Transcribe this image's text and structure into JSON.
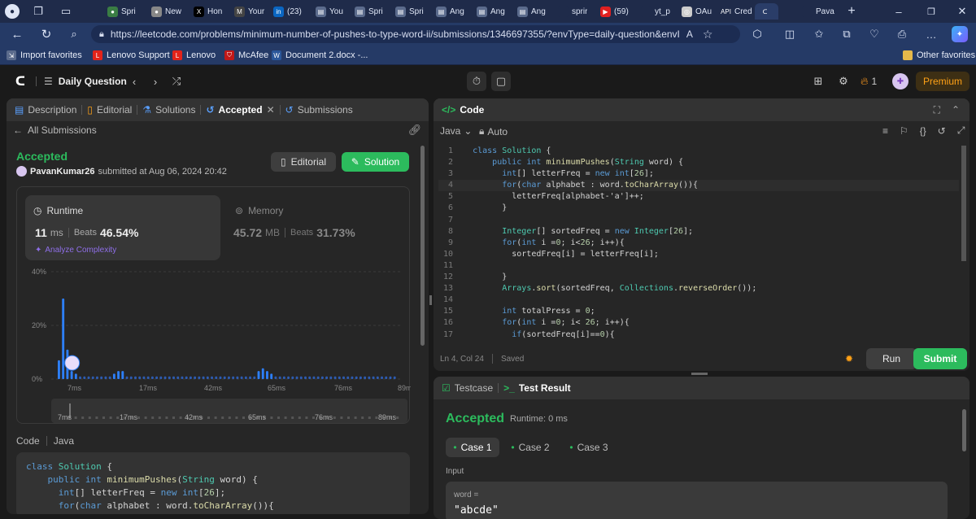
{
  "browser": {
    "tabs": [
      {
        "label": "Spri",
        "icon": "circle-icon",
        "color": "#3a7d44"
      },
      {
        "label": "New",
        "icon": "circle-icon",
        "color": "#888888"
      },
      {
        "label": "Hon",
        "icon": "x-icon",
        "color": "#000000"
      },
      {
        "label": "Your",
        "icon": "gmail-icon",
        "color": "#444444"
      },
      {
        "label": "(23)",
        "icon": "linkedin-icon",
        "color": "#0a66c2"
      },
      {
        "label": "You",
        "icon": "page-icon",
        "color": "#5b6b8c"
      },
      {
        "label": "Spri",
        "icon": "page-icon",
        "color": "#5b6b8c"
      },
      {
        "label": "Spri",
        "icon": "page-icon",
        "color": "#5b6b8c"
      },
      {
        "label": "Ang",
        "icon": "page-icon",
        "color": "#5b6b8c"
      },
      {
        "label": "Ang",
        "icon": "page-icon",
        "color": "#5b6b8c"
      },
      {
        "label": "Ang",
        "icon": "page-icon",
        "color": "#5b6b8c"
      },
      {
        "label": "sprir",
        "icon": "blank-icon",
        "color": "#1f2b4a"
      },
      {
        "label": "(59)",
        "icon": "youtube-icon",
        "color": "#e02020"
      },
      {
        "label": "yt_p",
        "icon": "blank-icon",
        "color": "#1f2b4a"
      },
      {
        "label": "OAu",
        "icon": "openai-icon",
        "color": "#cccccc"
      },
      {
        "label": "Cred",
        "icon": "api-icon",
        "color": "#1f2b4a"
      },
      {
        "label": "",
        "icon": "leetcode-icon",
        "color": "#2a3d68"
      },
      {
        "label": "Pava",
        "icon": "blank-icon",
        "color": "#1f2b4a"
      }
    ],
    "url": "https://leetcode.com/problems/minimum-number-of-pushes-to-type-word-ii/submissions/1346697355/?envType=daily-question&envI...",
    "favorites": [
      {
        "label": "Import favorites",
        "icon": "import-icon",
        "color": "#5b6b8c"
      },
      {
        "label": "Lenovo Support",
        "icon": "L",
        "color": "#e2231a"
      },
      {
        "label": "Lenovo",
        "icon": "L",
        "color": "#e2231a"
      },
      {
        "label": "McAfee",
        "icon": "shield-icon",
        "color": "#c01818"
      },
      {
        "label": "Document 2.docx -...",
        "icon": "W",
        "color": "#2b579a"
      }
    ],
    "other_favorites": "Other favorites"
  },
  "nav": {
    "daily": "Daily Question",
    "streak": "1",
    "premium": "Premium"
  },
  "left": {
    "tabs": [
      "Description",
      "Editorial",
      "Solutions",
      "Accepted",
      "Submissions"
    ],
    "back": "All Submissions",
    "status": "Accepted",
    "user": "PavanKumar26",
    "submitted": "submitted at Aug 06, 2024 20:42",
    "editorial_btn": "Editorial",
    "solution_btn": "Solution",
    "runtime": {
      "title": "Runtime",
      "value": "11",
      "unit": "ms",
      "beats_label": "Beats",
      "beats": "46.54%",
      "analyze": "Analyze Complexity"
    },
    "memory": {
      "title": "Memory",
      "value": "45.72",
      "unit": "MB",
      "beats_label": "Beats",
      "beats": "31.73%"
    },
    "code_label": "Code",
    "code_lang": "Java"
  },
  "chart_data": {
    "type": "bar",
    "y_ticks": [
      "40%",
      "20%",
      "0%"
    ],
    "ylim": [
      0,
      40
    ],
    "x_ticks": [
      "7ms",
      "17ms",
      "42ms",
      "65ms",
      "76ms",
      "89ms"
    ],
    "values": [
      7,
      30,
      11,
      3,
      2,
      1,
      1,
      1,
      1,
      1,
      1,
      1,
      1,
      2,
      3,
      3,
      1,
      1,
      1,
      1,
      1,
      1,
      1,
      1,
      1,
      1,
      1,
      1,
      1,
      1,
      1,
      1,
      1,
      1,
      1,
      1,
      1,
      1,
      1,
      1,
      1,
      1,
      1,
      1,
      1,
      1,
      1,
      3,
      4,
      3,
      2,
      1,
      1,
      1,
      1,
      1,
      1,
      1,
      1,
      1,
      1,
      1,
      1,
      1,
      1,
      1,
      1,
      1,
      1,
      1,
      1,
      1,
      1,
      1,
      1,
      1,
      1,
      1,
      1,
      1
    ],
    "highlight_index": 3,
    "mini_ticks": [
      "7ms",
      "17ms",
      "42ms",
      "65ms",
      "76ms",
      "89ms"
    ]
  },
  "editor": {
    "title": "Code",
    "lang": "Java",
    "mode": "Auto",
    "status_pos": "Ln 4, Col 24",
    "status_saved": "Saved",
    "run": "Run",
    "submit": "Submit",
    "lines": [
      "class Solution {",
      "    public int minimumPushes(String word) {",
      "      int[] letterFreq = new int[26];",
      "      for(char alphabet : word.toCharArray()){",
      "        letterFreq[alphabet-'a']++;",
      "      }",
      "",
      "      Integer[] sortedFreq = new Integer[26];",
      "      for(int i =0; i<26; i++){",
      "        sortedFreq[i] = letterFreq[i];",
      "",
      "      }",
      "      Arrays.sort(sortedFreq, Collections.reverseOrder());",
      "",
      "      int totalPress = 0;",
      "      for(int i =0; i< 26; i++){",
      "        if(sortedFreq[i]==0){"
    ]
  },
  "submission_code": [
    "class Solution {",
    "    public int minimumPushes(String word) {",
    "      int[] letterFreq = new int[26];",
    "      for(char alphabet : word.toCharArray()){"
  ],
  "result": {
    "testcase_tab": "Testcase",
    "result_tab": "Test Result",
    "status": "Accepted",
    "runtime": "Runtime: 0 ms",
    "cases": [
      "Case 1",
      "Case 2",
      "Case 3"
    ],
    "input_label": "Input",
    "var_label": "word =",
    "var_value": "\"abcde\""
  }
}
